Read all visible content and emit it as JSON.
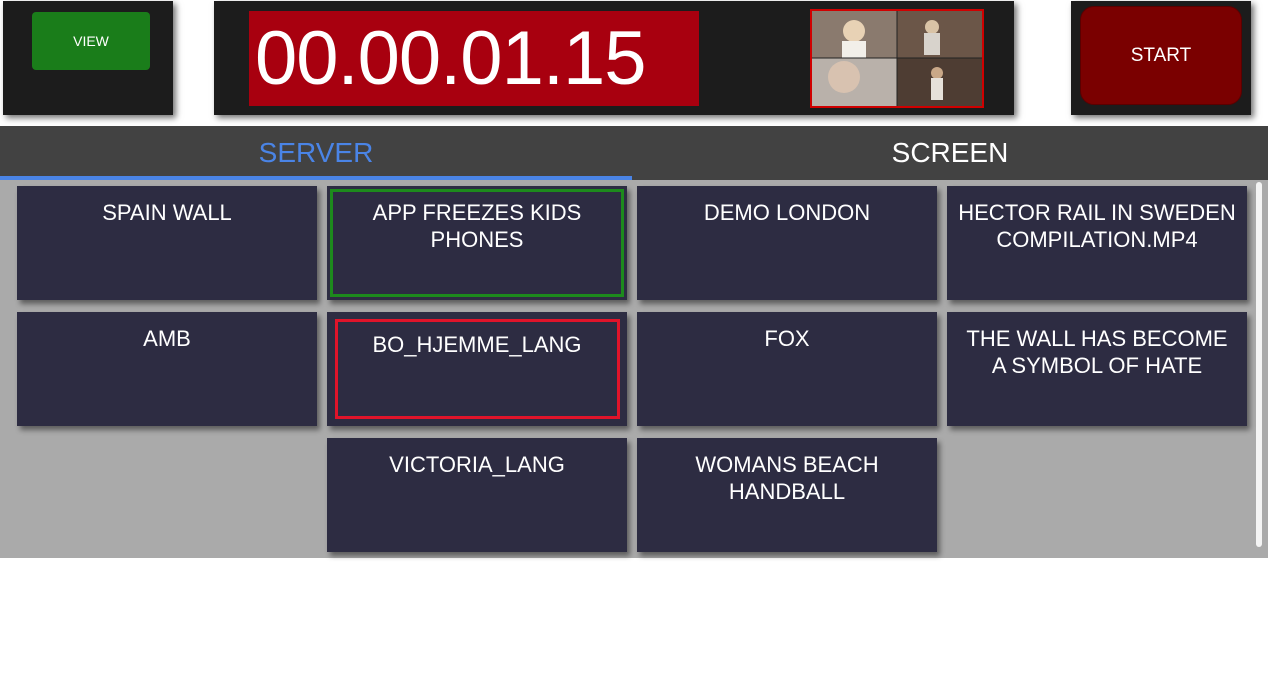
{
  "header": {
    "view_label": "VIEW",
    "timer": "00.00.01.15",
    "start_label": "START"
  },
  "tabs": [
    {
      "label": "SERVER",
      "active": true
    },
    {
      "label": "SCREEN",
      "active": false
    }
  ],
  "tiles": [
    {
      "label": "SPAIN WALL"
    },
    {
      "label": "APP FREEZES KIDS PHONES",
      "state": "selected-green"
    },
    {
      "label": "DEMO LONDON"
    },
    {
      "label": "HECTOR RAIL IN SWEDEN COMPILATION.MP4"
    },
    {
      "label": "AMB"
    },
    {
      "label": "BO_HJEMME_LANG",
      "state": "selected-red"
    },
    {
      "label": "FOX"
    },
    {
      "label": "THE WALL HAS BECOME A SYMBOL OF HATE"
    },
    {
      "label": "VICTORIA_LANG"
    },
    {
      "label": "WOMANS BEACH HANDBALL"
    }
  ],
  "colors": {
    "view_green": "#1a7d1a",
    "timer_red": "#a8000f",
    "start_dark_red": "#7a0000",
    "tab_active_blue": "#4a84e6",
    "tile_bg": "#2d2c42",
    "selected_green": "#1d8a1d",
    "selected_red": "#e0142a"
  }
}
